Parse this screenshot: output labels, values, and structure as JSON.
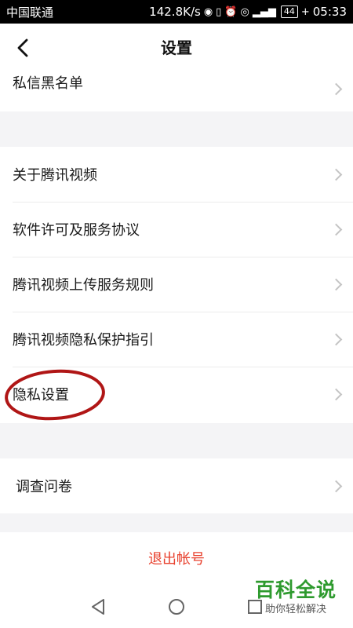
{
  "status_bar": {
    "carrier": "中国联通",
    "speed": "142.8K/s",
    "battery": "44",
    "time": "05:33"
  },
  "header": {
    "title": "设置"
  },
  "section1": {
    "items": [
      {
        "label": "私信黑名单"
      }
    ]
  },
  "section2": {
    "items": [
      {
        "label": "关于腾讯视频"
      },
      {
        "label": "软件许可及服务协议"
      },
      {
        "label": "腾讯视频上传服务规则"
      },
      {
        "label": "腾讯视频隐私保护指引"
      },
      {
        "label": "隐私设置"
      }
    ]
  },
  "section3": {
    "items": [
      {
        "label": "调查问卷"
      }
    ]
  },
  "logout": {
    "label": "退出帐号",
    "color": "#e8412e"
  },
  "watermark": {
    "main": "百科全说",
    "sub": "助你轻松解决"
  },
  "annotation_color": "#b01616"
}
